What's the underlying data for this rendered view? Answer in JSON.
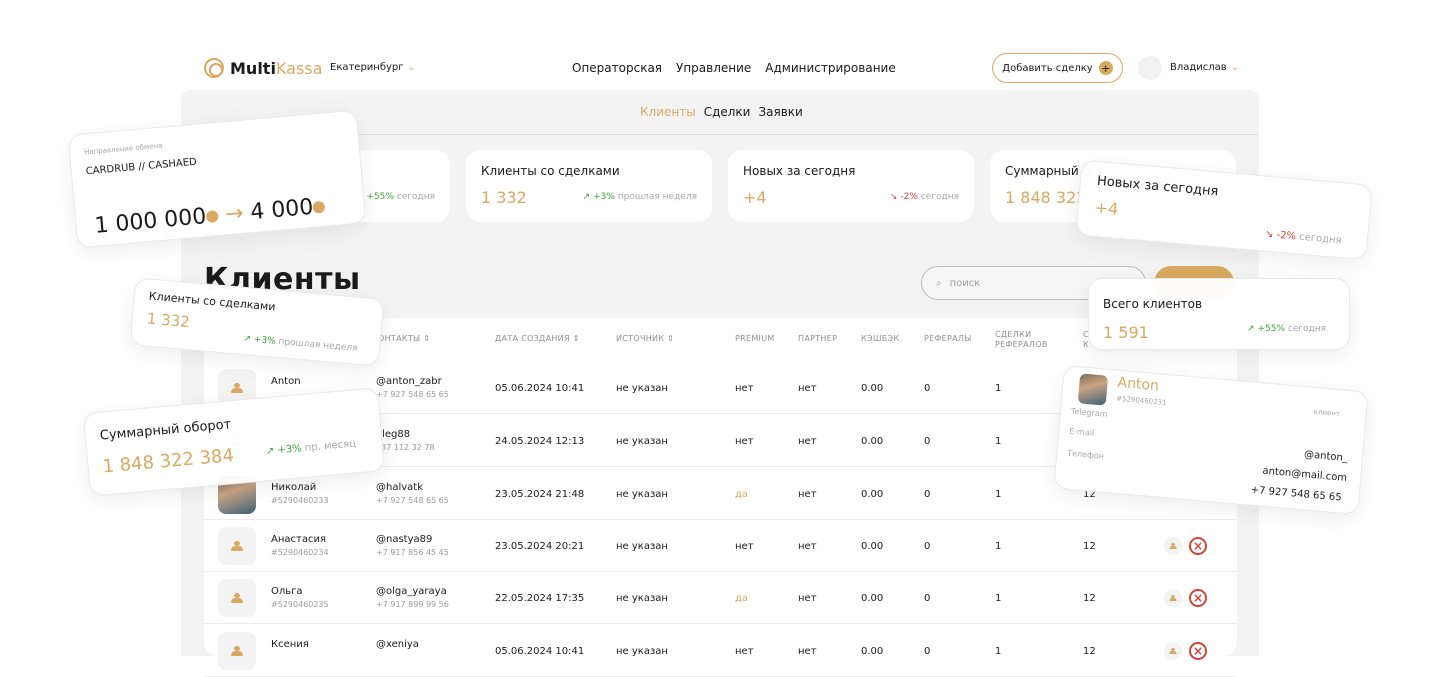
{
  "header": {
    "brand": {
      "bold": "Multi",
      "light": "Kassa"
    },
    "city": "Екатеринбург",
    "nav": [
      "Операторская",
      "Управление",
      "Администрирование"
    ],
    "add_deal_label": "Добавить сделку",
    "user_name": "Владислав"
  },
  "subtabs": [
    {
      "label": "Клиенты",
      "active": true
    },
    {
      "label": "Сделки",
      "active": false
    },
    {
      "label": "Заявки",
      "active": false
    }
  ],
  "stats": [
    {
      "title": "",
      "value": "",
      "delta": "+55%",
      "period": "сегодня"
    },
    {
      "title": "Клиенты со сделками",
      "value": "1 332",
      "delta": "+3%",
      "period": "прошлая неделя"
    },
    {
      "title": "Новых за сегодня",
      "value": "+4",
      "delta": "-2%",
      "period": "сегодня"
    },
    {
      "title": "Суммарный о",
      "value": "1 848 322",
      "delta": "",
      "period": ""
    }
  ],
  "main": {
    "title": "Клиенты",
    "search_placeholder": "поиск",
    "add_button_label": ""
  },
  "table": {
    "columns": [
      "КОНТАКТЫ",
      "ДАТА СОЗДАНИЯ",
      "ИСТОЧНИК",
      "PREMIUM",
      "ПАРТНЕР",
      "КЭШБЭК",
      "РЕФЕРАЛЫ",
      "СДЕЛКИ\nРЕФЕРАЛОВ",
      "С\nК"
    ],
    "rows": [
      {
        "name": "Anton",
        "id": "",
        "contact": "@anton_zabr",
        "phone": "+7 927 548 65 65",
        "date": "05.06.2024 10:41",
        "source": "не указан",
        "premium": "нет",
        "partner": "нет",
        "cashback": "0.00",
        "referrals": "0",
        "ref_deals": "1",
        "deals": ""
      },
      {
        "name": "",
        "id": "",
        "contact": "oleg88",
        "phone": "937 112 32 78",
        "date": "24.05.2024 12:13",
        "source": "не указан",
        "premium": "нет",
        "partner": "нет",
        "cashback": "0.00",
        "referrals": "0",
        "ref_deals": "1",
        "deals": ""
      },
      {
        "name": "Николай",
        "id": "#5290460233",
        "contact": "@halvatk",
        "phone": "+7 927 548 65 65",
        "date": "23.05.2024 21:48",
        "source": "не указан",
        "premium": "да",
        "partner": "нет",
        "cashback": "0.00",
        "referrals": "0",
        "ref_deals": "1",
        "deals": "12"
      },
      {
        "name": "Анастасия",
        "id": "#5290460234",
        "contact": "@nastya89",
        "phone": "+7 917 856 45 45",
        "date": "23.05.2024 20:21",
        "source": "не указан",
        "premium": "нет",
        "partner": "нет",
        "cashback": "0.00",
        "referrals": "0",
        "ref_deals": "1",
        "deals": "12"
      },
      {
        "name": "Ольга",
        "id": "#5290460235",
        "contact": "@olga_yaraya",
        "phone": "+7 917 899 99 56",
        "date": "22.05.2024 17:35",
        "source": "не указан",
        "premium": "да",
        "partner": "нет",
        "cashback": "0.00",
        "referrals": "0",
        "ref_deals": "1",
        "deals": "12"
      },
      {
        "name": "Ксения",
        "id": "",
        "contact": "@xeniya",
        "phone": "",
        "date": "05.06.2024 10:41",
        "source": "не указан",
        "premium": "нет",
        "partner": "нет",
        "cashback": "0.00",
        "referrals": "0",
        "ref_deals": "1",
        "deals": "12"
      }
    ]
  },
  "floating": {
    "exchange": {
      "label": "Направление обмена",
      "pair": "CARDRUB // CASHAED",
      "from": "1 000 000",
      "to": "4 000"
    },
    "clients_deals": {
      "title": "Клиенты со сделками",
      "value": "1 332",
      "delta": "+3%",
      "period": "прошлая неделя"
    },
    "turnover": {
      "title": "Суммарный оборот",
      "value": "1 848 322 384",
      "delta": "+3%",
      "period": "пр. месяц"
    },
    "new_today": {
      "title": "Новых за сегодня",
      "value": "+4",
      "delta": "-2%",
      "period": "сегодня"
    },
    "all_clients": {
      "title": "Всего клиентов",
      "value": "1 591",
      "delta": "+55%",
      "period": "сегодня"
    },
    "profile": {
      "name": "Anton",
      "id": "#5290460231",
      "role": "клиент",
      "telegram_label": "Telegram",
      "email_label": "E-mail",
      "phone_label": "Телефон",
      "telegram": "@anton_",
      "email": "anton@mail.com",
      "phone": "+7 927 548 65 65"
    }
  },
  "colors": {
    "accent": "#d9a961",
    "up": "#3aa33a",
    "down": "#d0443a"
  }
}
